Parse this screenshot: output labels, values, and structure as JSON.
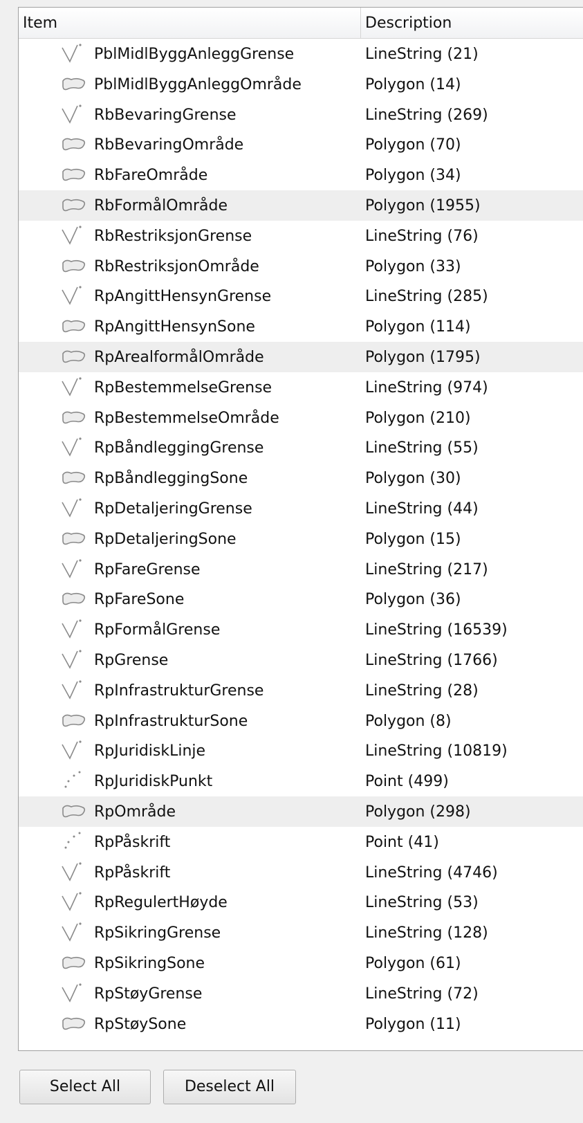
{
  "columns": {
    "item": "Item",
    "description": "Description"
  },
  "rows": [
    {
      "name": "PblMidlByggAnleggGrense",
      "description": "LineString (21)",
      "icon": "linestring-icon"
    },
    {
      "name": "PblMidlByggAnleggOmråde",
      "description": "Polygon (14)",
      "icon": "polygon-icon"
    },
    {
      "name": "RbBevaringGrense",
      "description": "LineString (269)",
      "icon": "linestring-icon"
    },
    {
      "name": "RbBevaringOmråde",
      "description": "Polygon (70)",
      "icon": "polygon-icon"
    },
    {
      "name": "RbFareOmråde",
      "description": "Polygon (34)",
      "icon": "polygon-icon"
    },
    {
      "name": "RbFormålOmråde",
      "description": "Polygon (1955)",
      "icon": "polygon-icon",
      "highlighted": true
    },
    {
      "name": "RbRestriksjonGrense",
      "description": "LineString (76)",
      "icon": "linestring-icon"
    },
    {
      "name": "RbRestriksjonOmråde",
      "description": "Polygon (33)",
      "icon": "polygon-icon"
    },
    {
      "name": "RpAngittHensynGrense",
      "description": "LineString (285)",
      "icon": "linestring-icon"
    },
    {
      "name": "RpAngittHensynSone",
      "description": "Polygon (114)",
      "icon": "polygon-icon"
    },
    {
      "name": "RpArealformålOmråde",
      "description": "Polygon (1795)",
      "icon": "polygon-icon",
      "highlighted": true
    },
    {
      "name": "RpBestemmelseGrense",
      "description": "LineString (974)",
      "icon": "linestring-icon"
    },
    {
      "name": "RpBestemmelseOmråde",
      "description": "Polygon (210)",
      "icon": "polygon-icon"
    },
    {
      "name": "RpBåndleggingGrense",
      "description": "LineString (55)",
      "icon": "linestring-icon"
    },
    {
      "name": "RpBåndleggingSone",
      "description": "Polygon (30)",
      "icon": "polygon-icon"
    },
    {
      "name": "RpDetaljeringGrense",
      "description": "LineString (44)",
      "icon": "linestring-icon"
    },
    {
      "name": "RpDetaljeringSone",
      "description": "Polygon (15)",
      "icon": "polygon-icon"
    },
    {
      "name": "RpFareGrense",
      "description": "LineString (217)",
      "icon": "linestring-icon"
    },
    {
      "name": "RpFareSone",
      "description": "Polygon (36)",
      "icon": "polygon-icon"
    },
    {
      "name": "RpFormålGrense",
      "description": "LineString (16539)",
      "icon": "linestring-icon"
    },
    {
      "name": "RpGrense",
      "description": "LineString (1766)",
      "icon": "linestring-icon"
    },
    {
      "name": "RpInfrastrukturGrense",
      "description": "LineString (28)",
      "icon": "linestring-icon"
    },
    {
      "name": "RpInfrastrukturSone",
      "description": "Polygon (8)",
      "icon": "polygon-icon"
    },
    {
      "name": "RpJuridiskLinje",
      "description": "LineString (10819)",
      "icon": "linestring-icon"
    },
    {
      "name": "RpJuridiskPunkt",
      "description": "Point (499)",
      "icon": "point-icon"
    },
    {
      "name": "RpOmråde",
      "description": "Polygon (298)",
      "icon": "polygon-icon",
      "highlighted": true
    },
    {
      "name": "RpPåskrift",
      "description": "Point (41)",
      "icon": "point-icon"
    },
    {
      "name": "RpPåskrift",
      "description": "LineString (4746)",
      "icon": "linestring-icon"
    },
    {
      "name": "RpRegulertHøyde",
      "description": "LineString (53)",
      "icon": "linestring-icon"
    },
    {
      "name": "RpSikringGrense",
      "description": "LineString (128)",
      "icon": "linestring-icon"
    },
    {
      "name": "RpSikringSone",
      "description": "Polygon (61)",
      "icon": "polygon-icon"
    },
    {
      "name": "RpStøyGrense",
      "description": "LineString (72)",
      "icon": "linestring-icon"
    },
    {
      "name": "RpStøySone",
      "description": "Polygon (11)",
      "icon": "polygon-icon"
    }
  ],
  "buttons": {
    "select_all": "Select All",
    "deselect_all": "Deselect All"
  },
  "colors": {
    "highlight_row": "#eeeeee",
    "background": "#f0f0f0",
    "icon_stroke": "#8a8a8a"
  }
}
